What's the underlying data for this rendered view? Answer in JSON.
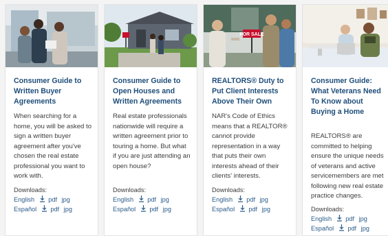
{
  "cards": [
    {
      "title": "Consumer Guide to Written Buyer Agreements",
      "body": "When searching for a home, you will be asked to sign a written buyer agreement after you've chosen the real estate professional you want to work with.",
      "downloads_label": "Downloads:",
      "downloads": [
        {
          "language": "English",
          "pdf": "pdf",
          "jpg": "jpg"
        },
        {
          "language": "Español",
          "pdf": "pdf",
          "jpg": "jpg"
        }
      ]
    },
    {
      "title": "Consumer Guide to Open Houses and Written Agreements",
      "body": "Real estate professionals nationwide will require a written agreement prior to touring a home. But what if you are just attending an open house?",
      "downloads_label": "Downloads:",
      "downloads": [
        {
          "language": "English",
          "pdf": "pdf",
          "jpg": "jpg"
        },
        {
          "language": "Español",
          "pdf": "pdf",
          "jpg": "jpg"
        }
      ]
    },
    {
      "title": "REALTORS® Duty to Put Client Interests Above Their Own",
      "body": "NAR's Code of Ethics means that a REALTOR® cannot provide representation in a way that puts their own interests ahead of their clients' interests.",
      "photo_sign": "FOR SALE",
      "downloads_label": "Downloads:",
      "downloads": [
        {
          "language": "English",
          "pdf": "pdf",
          "jpg": "jpg"
        },
        {
          "language": "Español",
          "pdf": "pdf",
          "jpg": "jpg"
        }
      ]
    },
    {
      "title": "Consumer Guide: What Veterans Need To Know about Buying a Home",
      "body": "REALTORS® are committed to helping ensure the unique needs of veterans and active servicemembers are met following new real estate practice changes.",
      "downloads_label": "Downloads:",
      "downloads": [
        {
          "language": "English",
          "pdf": "pdf",
          "jpg": "jpg"
        },
        {
          "language": "Español",
          "pdf": "pdf",
          "jpg": "jpg"
        }
      ]
    }
  ],
  "icons": {
    "download": "download-icon"
  },
  "colors": {
    "title": "#1f4e7a",
    "link": "#2b5c8a",
    "body": "#3b3b3b",
    "card_bg": "#ffffff"
  }
}
